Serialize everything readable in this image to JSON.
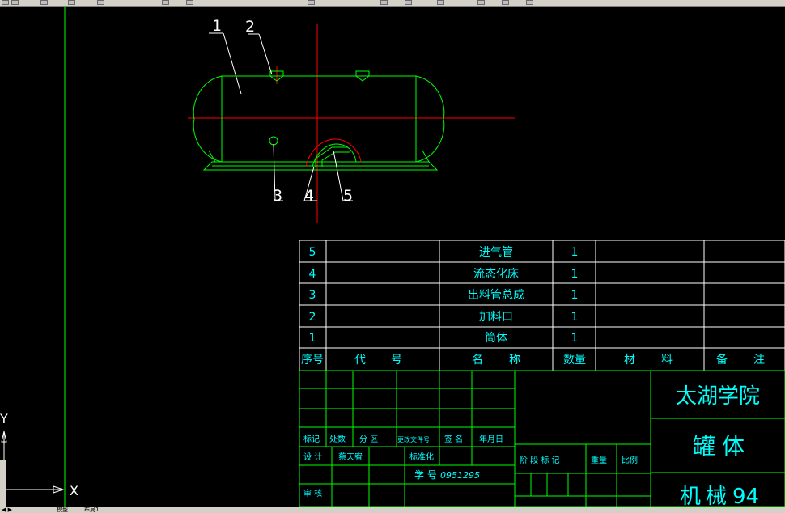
{
  "drawing": {
    "balloons": [
      "1",
      "2",
      "3",
      "4",
      "5"
    ]
  },
  "bom": {
    "rows": [
      {
        "seq": "5",
        "name": "进气管",
        "qty": "1"
      },
      {
        "seq": "4",
        "name": "流态化床",
        "qty": "1"
      },
      {
        "seq": "3",
        "name": "出料管总成",
        "qty": "1"
      },
      {
        "seq": "2",
        "name": "加料口",
        "qty": "1"
      },
      {
        "seq": "1",
        "name": "筒体",
        "qty": "1"
      }
    ],
    "header": {
      "seq": "序号",
      "code_a": "代",
      "code_b": "号",
      "name_a": "名",
      "name_b": "称",
      "qty": "数量",
      "mat_a": "材",
      "mat_b": "料",
      "note_a": "备",
      "note_b": "注"
    }
  },
  "title_block": {
    "school": "太湖学院",
    "part_a": "罐",
    "part_b": "体",
    "dept_a": "机",
    "dept_b": "械",
    "dept_num": "94",
    "rev_labels": [
      "标记",
      "处数",
      "分 区",
      "更改文件号",
      "签 名",
      "年月日"
    ],
    "design_label": "设 计",
    "designer": "蔡天宥",
    "std_label": "标准化",
    "review_label": "审 核",
    "student_label": "学 号",
    "student_no": "0951295",
    "stage_label": "阶 段 标 记",
    "weight_label": "重量",
    "scale_label": "比例"
  },
  "ucs": {
    "x_label": "X",
    "y_label": "Y"
  },
  "status": {
    "tab_model": "模型",
    "tab_layout": "布局1"
  },
  "colors": {
    "background": "#000000",
    "outline": "#00ff00",
    "center": "#ff0000",
    "text": "#00ffff",
    "white": "#ffffff"
  }
}
